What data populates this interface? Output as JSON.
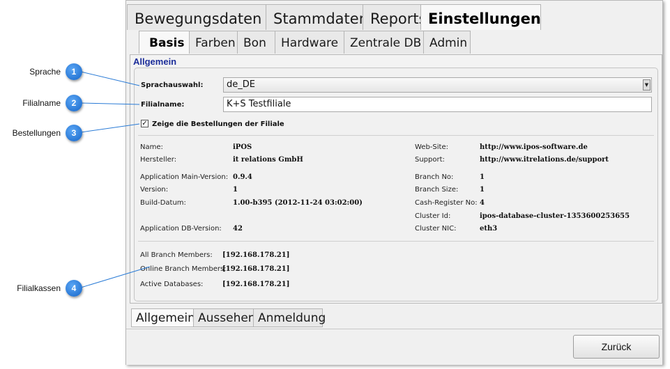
{
  "main_tabs": [
    "Bewegungsdaten",
    "Stammdaten",
    "Reports",
    "Einstellungen"
  ],
  "sub_tabs": [
    "Basis",
    "Farben",
    "Bon",
    "Hardware",
    "Zentrale DB",
    "Admin"
  ],
  "section_title": "Allgemein",
  "form": {
    "language_label": "Sprachauswahl:",
    "language_value": "de_DE",
    "branch_label": "Filialname:",
    "branch_value": "K+S Testfiliale",
    "orders_checkbox_label": "Zeige die Bestellungen der Filiale",
    "orders_checked": true
  },
  "info_left": [
    {
      "key": "Name:",
      "value": "iPOS"
    },
    {
      "key": "Hersteller:",
      "value": "it relations GmbH"
    },
    {
      "key": "Application Main-Version:",
      "value": "0.9.4"
    },
    {
      "key": "Version:",
      "value": "1"
    },
    {
      "key": "Build-Datum:",
      "value": "1.00-b395 (2012-11-24 03:02:00)"
    },
    {
      "key": "Application DB-Version:",
      "value": "42"
    }
  ],
  "info_right": [
    {
      "key": "Web-Site:",
      "value": "http://www.ipos-software.de"
    },
    {
      "key": "Support:",
      "value": "http://www.itrelations.de/support"
    },
    {
      "key": "Branch No:",
      "value": "1"
    },
    {
      "key": "Branch Size:",
      "value": "1"
    },
    {
      "key": "Cash-Register No:",
      "value": "4"
    },
    {
      "key": "Cluster Id:",
      "value": "ipos-database-cluster-1353600253655"
    },
    {
      "key": "Cluster NIC:",
      "value": "eth3"
    }
  ],
  "members": [
    {
      "key": "All Branch Members:",
      "value": "[192.168.178.21]"
    },
    {
      "key": "Online Branch Members:",
      "value": "[192.168.178.21]"
    },
    {
      "key": "Active Databases:",
      "value": "[192.168.178.21]"
    }
  ],
  "bottom_tabs": [
    "Allgemein",
    "Aussehen",
    "Anmeldung"
  ],
  "back_button": "Zurück",
  "callouts": [
    {
      "label": "Sprache",
      "num": "1"
    },
    {
      "label": "Filialname",
      "num": "2"
    },
    {
      "label": "Bestellungen",
      "num": "3"
    },
    {
      "label": "Filialkassen",
      "num": "4"
    }
  ],
  "colors": {
    "section_title": "#1c2e9a",
    "badge": "#1e73d6"
  }
}
